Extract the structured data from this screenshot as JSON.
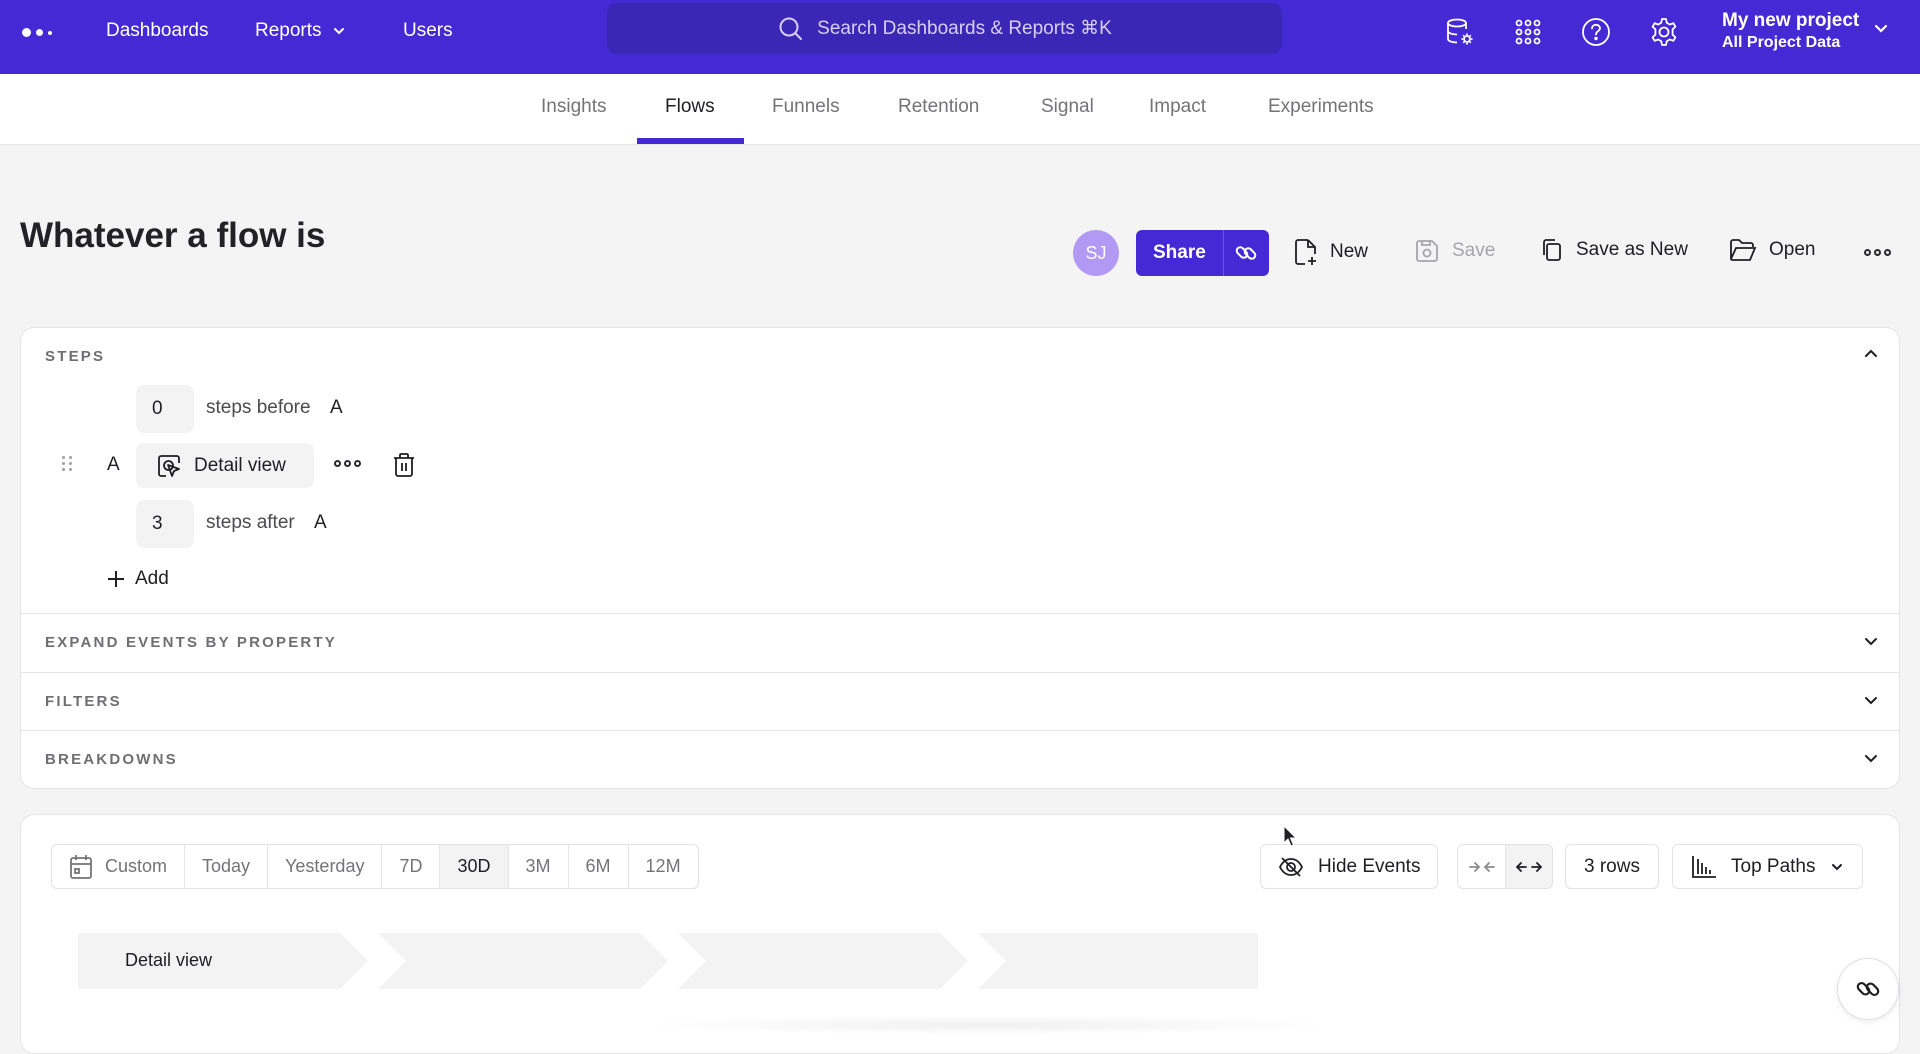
{
  "topnav": {
    "logo": "mixpanel-logo",
    "links": [
      {
        "label": "Dashboards"
      },
      {
        "label": "Reports",
        "has_dropdown": true
      },
      {
        "label": "Users"
      }
    ],
    "search_placeholder": "Search Dashboards & Reports ⌘K",
    "icons": [
      "data-settings-icon",
      "apps-grid-icon",
      "help-icon",
      "settings-gear-icon"
    ],
    "project": {
      "name": "My new project",
      "subtitle": "All Project Data"
    }
  },
  "tabs": {
    "items": [
      {
        "label": "Insights"
      },
      {
        "label": "Flows",
        "active": true
      },
      {
        "label": "Funnels"
      },
      {
        "label": "Retention"
      },
      {
        "label": "Signal"
      },
      {
        "label": "Impact"
      },
      {
        "label": "Experiments"
      }
    ]
  },
  "report": {
    "title": "Whatever a flow is",
    "avatar_initials": "SJ",
    "toolbar": {
      "share": "Share",
      "new": "New",
      "save": "Save",
      "save_as_new": "Save as New",
      "open": "Open"
    }
  },
  "steps": {
    "label": "STEPS",
    "before_count": "0",
    "before_text": "steps before",
    "anchor_letter": "A",
    "event_name": "Detail view",
    "after_count": "3",
    "after_text": "steps after",
    "add_label": "Add"
  },
  "sections": [
    {
      "label": "EXPAND EVENTS BY PROPERTY"
    },
    {
      "label": "FILTERS"
    },
    {
      "label": "BREAKDOWNS"
    }
  ],
  "results": {
    "date_ranges": [
      {
        "label": "Custom",
        "icon": "calendar-icon"
      },
      {
        "label": "Today"
      },
      {
        "label": "Yesterday"
      },
      {
        "label": "7D"
      },
      {
        "label": "30D",
        "active": true
      },
      {
        "label": "3M"
      },
      {
        "label": "6M"
      },
      {
        "label": "12M"
      }
    ],
    "hide_events": "Hide Events",
    "rows": "3 rows",
    "view_mode": "Top Paths",
    "flow_columns": [
      "Detail view",
      "",
      "",
      ""
    ]
  },
  "colors": {
    "brand": "#4429d5",
    "avatar": "#b29af4"
  }
}
